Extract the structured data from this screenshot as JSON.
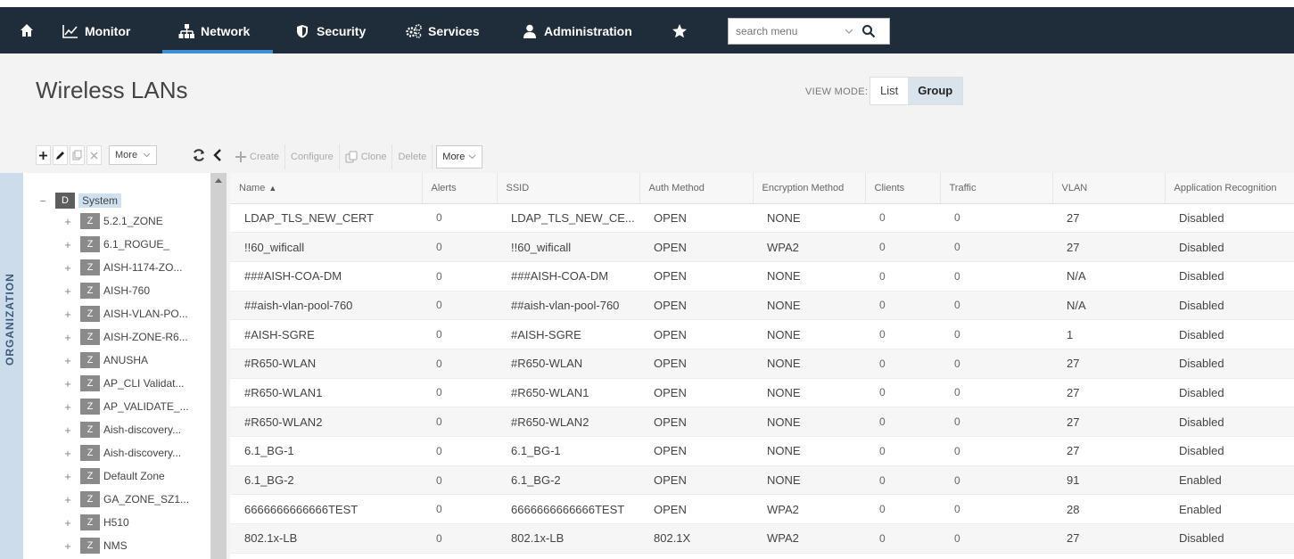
{
  "nav": {
    "home_icon": "home-icon",
    "items": [
      {
        "label": "Monitor",
        "icon": "chart-line-icon"
      },
      {
        "label": "Network",
        "icon": "network-tree-icon"
      },
      {
        "label": "Security",
        "icon": "shield-icon"
      },
      {
        "label": "Services",
        "icon": "gears-icon"
      },
      {
        "label": "Administration",
        "icon": "user-icon"
      }
    ],
    "active": "Network",
    "favorite_icon": "star-icon",
    "search_placeholder": "search menu",
    "colors": {
      "bar": "#1f2c3a",
      "accent": "#3c8fd4"
    }
  },
  "page": {
    "title": "Wireless LANs",
    "view_mode_label": "VIEW MODE:",
    "view_modes": [
      "List",
      "Group"
    ],
    "view_mode_active": "Group"
  },
  "tree_toolbar": {
    "more_label": "More"
  },
  "org_tab": "ORGANIZATION",
  "tree": {
    "root": {
      "badge": "D",
      "label": "System"
    },
    "zones": [
      "5.2.1_ZONE",
      "6.1_ROGUE_",
      "AISH-1174-ZO...",
      "AISH-760",
      "AISH-VLAN-PO...",
      "AISH-ZONE-R6...",
      "ANUSHA",
      "AP_CLI Validat...",
      "AP_VALIDATE_...",
      "Aish-discovery...",
      "Aish-discovery...",
      "Default Zone",
      "GA_ZONE_SZ1...",
      "H510",
      "NMS"
    ],
    "zone_badge": "Z"
  },
  "grid_toolbar": {
    "create": "Create",
    "configure": "Configure",
    "clone": "Clone",
    "delete": "Delete",
    "more": "More"
  },
  "table": {
    "columns": [
      "Name",
      "Alerts",
      "SSID",
      "Auth Method",
      "Encryption Method",
      "Clients",
      "Traffic",
      "VLAN",
      "Application Recognition"
    ],
    "rows": [
      [
        "LDAP_TLS_NEW_CERT",
        "0",
        "LDAP_TLS_NEW_CE...",
        "OPEN",
        "NONE",
        "0",
        "0",
        "27",
        "Disabled"
      ],
      [
        "!!60_wificall",
        "0",
        "!!60_wificall",
        "OPEN",
        "WPA2",
        "0",
        "0",
        "27",
        "Disabled"
      ],
      [
        "###AISH-COA-DM",
        "0",
        "###AISH-COA-DM",
        "OPEN",
        "NONE",
        "0",
        "0",
        "N/A",
        "Disabled"
      ],
      [
        "##aish-vlan-pool-760",
        "0",
        "##aish-vlan-pool-760",
        "OPEN",
        "NONE",
        "0",
        "0",
        "N/A",
        "Disabled"
      ],
      [
        "#AISH-SGRE",
        "0",
        "#AISH-SGRE",
        "OPEN",
        "NONE",
        "0",
        "0",
        "1",
        "Disabled"
      ],
      [
        "#R650-WLAN",
        "0",
        "#R650-WLAN",
        "OPEN",
        "NONE",
        "0",
        "0",
        "27",
        "Disabled"
      ],
      [
        "#R650-WLAN1",
        "0",
        "#R650-WLAN1",
        "OPEN",
        "NONE",
        "0",
        "0",
        "27",
        "Disabled"
      ],
      [
        "#R650-WLAN2",
        "0",
        "#R650-WLAN2",
        "OPEN",
        "NONE",
        "0",
        "0",
        "27",
        "Disabled"
      ],
      [
        "6.1_BG-1",
        "0",
        "6.1_BG-1",
        "OPEN",
        "NONE",
        "0",
        "0",
        "27",
        "Disabled"
      ],
      [
        "6.1_BG-2",
        "0",
        "6.1_BG-2",
        "OPEN",
        "NONE",
        "0",
        "0",
        "91",
        "Enabled"
      ],
      [
        "6666666666666TEST",
        "0",
        "6666666666666TEST",
        "OPEN",
        "WPA2",
        "0",
        "0",
        "28",
        "Enabled"
      ],
      [
        "802.1x-LB",
        "0",
        "802.1x-LB",
        "802.1X",
        "WPA2",
        "0",
        "0",
        "27",
        "Disabled"
      ]
    ]
  }
}
